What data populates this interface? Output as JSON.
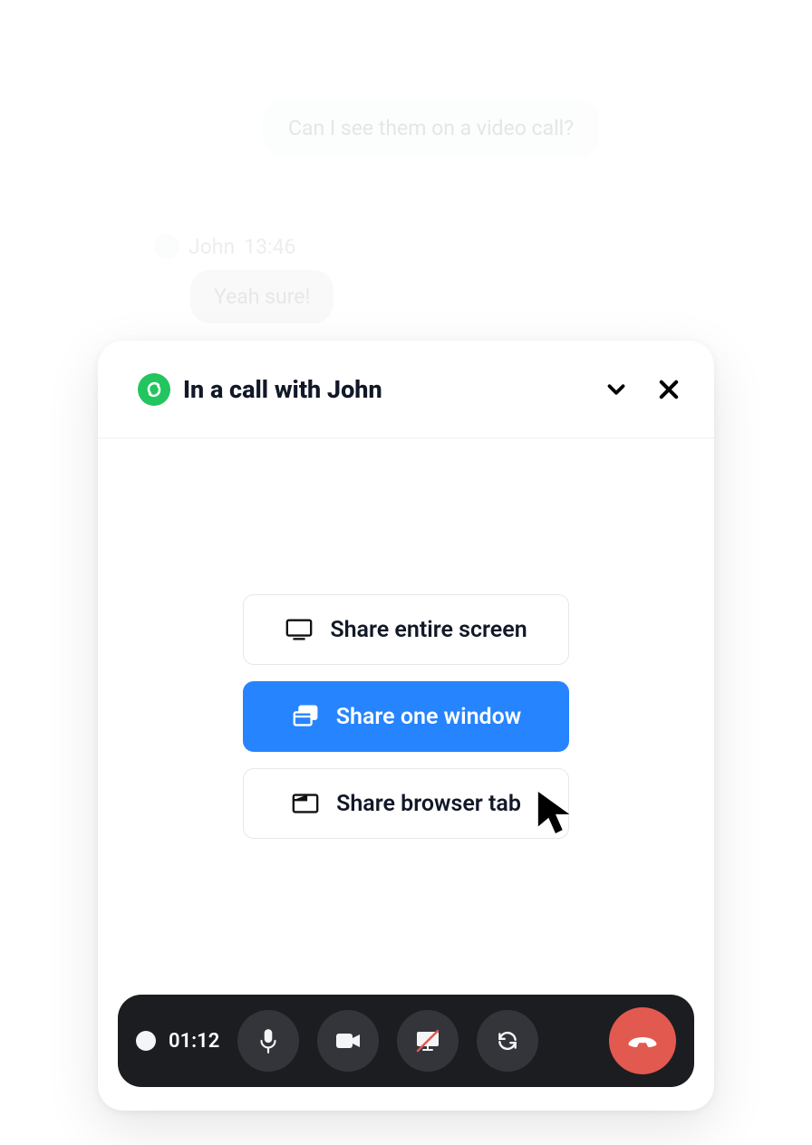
{
  "chat": {
    "outgoing": "Can I see them on a video call?",
    "sender": "John",
    "time": "13:46",
    "incoming": "Yeah sure!"
  },
  "call": {
    "title": "In a call with John",
    "options": {
      "share_screen": "Share entire screen",
      "share_window": "Share one window",
      "share_tab": "Share browser tab"
    },
    "bar": {
      "time": "01:12"
    }
  }
}
